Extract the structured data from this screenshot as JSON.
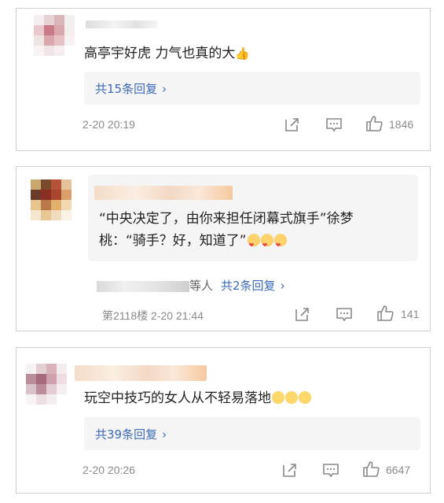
{
  "comments": [
    {
      "content": "高亭宇好虎 力气也真的大",
      "reply_link": "共15条回复",
      "time": "2-20 20:19",
      "likes": "1846",
      "avatar": [
        "#f6eef0",
        "#e7d3d6",
        "#d9b5ba",
        "#f3f0f0",
        "#e9c9cd",
        "#c87b86",
        "#dba7ae",
        "#f4eeee",
        "#efe3e4",
        "#d9a7ad",
        "#e6c1c5",
        "#f7f2f3",
        "#f8f4f4",
        "#f1e4e6",
        "#f6eef0",
        "#ffffff"
      ]
    },
    {
      "content_line1": "“中央决定了，由你来担任闭幕式旗手”徐梦",
      "content_line2": "桃：“骑手？好，知道了”",
      "others_suffix": "等人",
      "reply_link": "共2条回复",
      "floor_time": "第2118楼 2-20 21:44",
      "likes": "141",
      "avatar": [
        "#c9a86f",
        "#7a4a2c",
        "#b5523a",
        "#e4c29a",
        "#6b3a2a",
        "#8b2f24",
        "#a8462f",
        "#d9a06a",
        "#e7c58f",
        "#b77a48",
        "#e2b06a",
        "#f1d9b2",
        "#f5e6cf",
        "#e9c896",
        "#f2dcc0",
        "#fbf2e6"
      ]
    },
    {
      "content": "玩空中技巧的女人从不轻易落地",
      "reply_link": "共39条回复",
      "time": "2-20 20:26",
      "likes": "6647",
      "avatar": [
        "#f7f2f3",
        "#e4cfd3",
        "#d8b3ba",
        "#f2ecee",
        "#b98d99",
        "#a56a7b",
        "#cfa0ad",
        "#eedde2",
        "#d9c2c9",
        "#bb8c99",
        "#e3cdd3",
        "#f6eff1",
        "#f8f4f5",
        "#ece0e3",
        "#f5eef0",
        "#ffffff"
      ]
    }
  ]
}
